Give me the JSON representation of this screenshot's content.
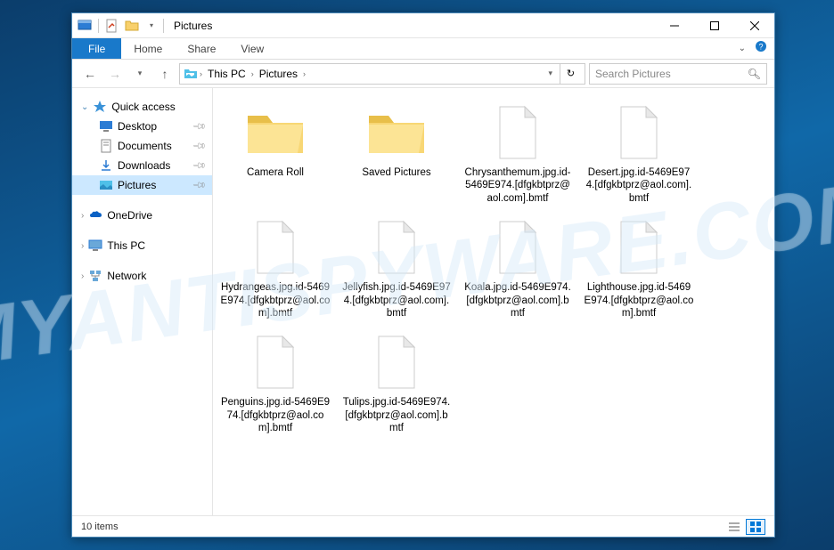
{
  "watermark": "MYANTISPYWARE.COM",
  "window": {
    "title": "Pictures"
  },
  "ribbon": {
    "tabs": {
      "file": "File",
      "home": "Home",
      "share": "Share",
      "view": "View"
    }
  },
  "breadcrumb": {
    "seg1": "This PC",
    "seg2": "Pictures"
  },
  "search": {
    "placeholder": "Search Pictures"
  },
  "sidebar": {
    "quick_access": "Quick access",
    "desktop": "Desktop",
    "documents": "Documents",
    "downloads": "Downloads",
    "pictures": "Pictures",
    "onedrive": "OneDrive",
    "this_pc": "This PC",
    "network": "Network"
  },
  "items": [
    {
      "name": "Camera Roll",
      "type": "folder"
    },
    {
      "name": "Saved Pictures",
      "type": "folder"
    },
    {
      "name": "Chrysanthemum.jpg.id-5469E974.[dfgkbtprz@aol.com].bmtf",
      "type": "file"
    },
    {
      "name": "Desert.jpg.id-5469E974.[dfgkbtprz@aol.com].bmtf",
      "type": "file"
    },
    {
      "name": "Hydrangeas.jpg.id-5469E974.[dfgkbtprz@aol.com].bmtf",
      "type": "file"
    },
    {
      "name": "Jellyfish.jpg.id-5469E974.[dfgkbtprz@aol.com].bmtf",
      "type": "file"
    },
    {
      "name": "Koala.jpg.id-5469E974.[dfgkbtprz@aol.com].bmtf",
      "type": "file"
    },
    {
      "name": "Lighthouse.jpg.id-5469E974.[dfgkbtprz@aol.com].bmtf",
      "type": "file"
    },
    {
      "name": "Penguins.jpg.id-5469E974.[dfgkbtprz@aol.com].bmtf",
      "type": "file"
    },
    {
      "name": "Tulips.jpg.id-5469E974.[dfgkbtprz@aol.com].bmtf",
      "type": "file"
    }
  ],
  "status": {
    "count": "10 items"
  }
}
